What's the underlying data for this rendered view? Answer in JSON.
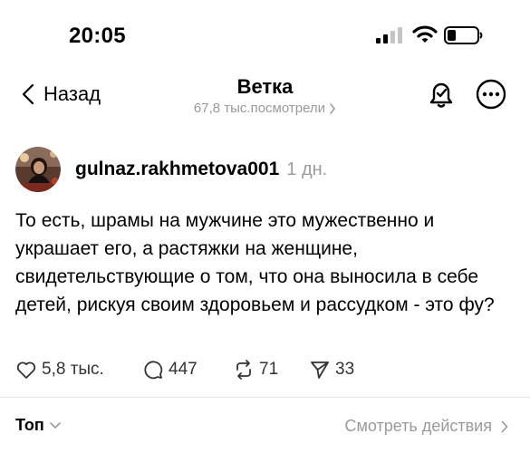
{
  "status_bar": {
    "time": "20:05",
    "icons": [
      "signal-icon",
      "wifi-icon",
      "battery-icon"
    ]
  },
  "nav": {
    "back_label": "Назад",
    "title": "Ветка",
    "views": "67,8 тыс.посмотрели",
    "icons": [
      "chevron-left-icon",
      "bell-icon",
      "more-icon"
    ]
  },
  "post": {
    "username": "gulnaz.rakhmetova001",
    "time": "1 дн.",
    "text": "То есть, шрамы на мужчине это мужественно и украшает его, а растяжки на женщине, свидетельствующие о том, что она выносила в себе детей, рискуя своим здоровьем и рассудком - это фу?",
    "likes": "5,8 тыс.",
    "replies": "447",
    "reposts": "71",
    "shares": "33"
  },
  "footer": {
    "sort_label": "Топ",
    "view_activity_label": "Смотреть действия"
  },
  "colors": {
    "text": "#000000",
    "muted": "#9a9a9a",
    "divider": "#e6e6e6",
    "background": "#ffffff"
  }
}
